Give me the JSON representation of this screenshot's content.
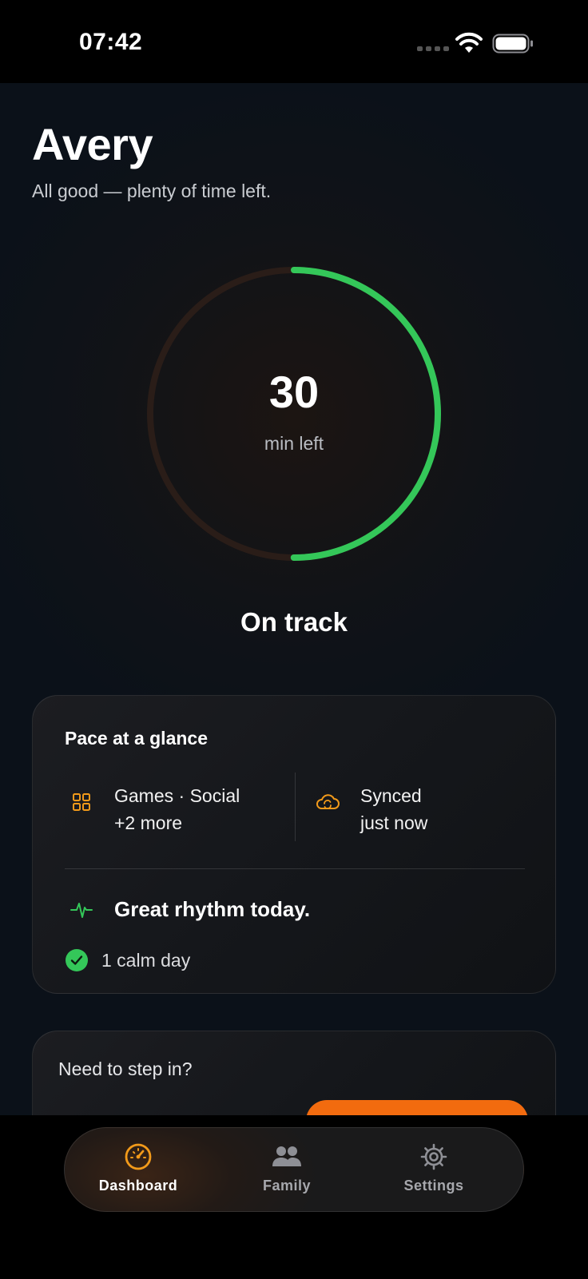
{
  "status_bar": {
    "time": "07:42"
  },
  "header": {
    "title": "Avery",
    "subtitle": "All good — plenty of time left."
  },
  "ring": {
    "value": "30",
    "unit": "min left",
    "progress_fraction": 0.5,
    "progress_color": "#34c759",
    "track_color": "#2a1d18"
  },
  "status": {
    "label": "On track"
  },
  "pace_card": {
    "heading": "Pace at a glance",
    "apps": {
      "line1": "Games · Social",
      "line2": "+2 more",
      "icon": "grid-icon"
    },
    "sync": {
      "line1": "Synced",
      "line2": "just now",
      "icon": "cloud-sync-icon"
    },
    "rhythm": {
      "text": "Great rhythm today.",
      "icon": "pulse-icon"
    },
    "calm": {
      "text": "1 calm day",
      "icon": "check-circle-icon"
    }
  },
  "step_card": {
    "heading": "Need to step in?"
  },
  "tab_bar": {
    "tabs": [
      {
        "label": "Dashboard",
        "icon": "gauge-icon",
        "active": true
      },
      {
        "label": "Family",
        "icon": "people-icon",
        "active": false
      },
      {
        "label": "Settings",
        "icon": "gear-icon",
        "active": false
      }
    ]
  },
  "colors": {
    "accent": "#f29a1a",
    "button": "#f26b0f",
    "success": "#34c759"
  }
}
